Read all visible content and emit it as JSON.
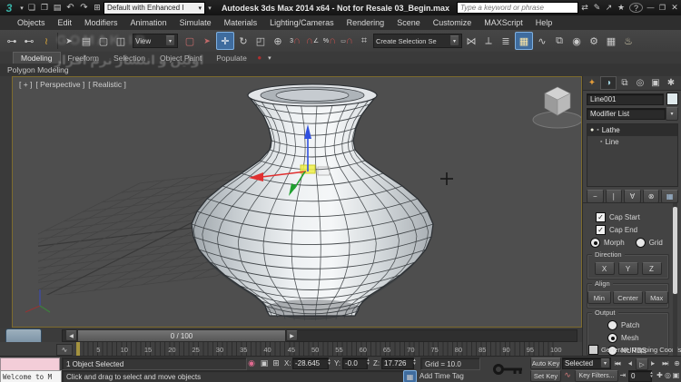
{
  "titlebar": {
    "title": "Autodesk 3ds Max 2014 x64  - Not for Resale   03_Begin.max",
    "workspace": "Default with Enhanced I",
    "search_placeholder": "Type a keyword or phrase"
  },
  "menus": [
    "Objects",
    "Edit",
    "Modifiers",
    "Animation",
    "Simulate",
    "Materials",
    "Lighting/Cameras",
    "Rendering",
    "Scene",
    "Customize",
    "MAXScript",
    "Help"
  ],
  "toolbar": {
    "ref_coord": "View",
    "selection_set": "Create Selection Se"
  },
  "ribbon": {
    "tabs": [
      "Modeling",
      "Freeform",
      "Selection",
      "Object Paint",
      "Populate"
    ],
    "panel": "Polygon Modeling"
  },
  "viewport": {
    "plus": "[ + ]",
    "view": "[ Perspective ]",
    "shading": "[ Realistic ]"
  },
  "panel": {
    "object_name": "Line001",
    "modifier_list": "Modifier List",
    "stack": [
      "Lathe",
      "Line"
    ],
    "cap_start": "Cap Start",
    "cap_end": "Cap End",
    "morph": "Morph",
    "grid": "Grid",
    "direction_label": "Direction",
    "dir": [
      "X",
      "Y",
      "Z"
    ],
    "align_label": "Align",
    "align": [
      "Min",
      "Center",
      "Max"
    ],
    "output_label": "Output",
    "output": [
      "Patch",
      "Mesh",
      "NURBS"
    ],
    "gen_map": "Generate Mapping Coords."
  },
  "timeline": {
    "slider": "0 / 100",
    "ticks": [
      5,
      10,
      15,
      20,
      25,
      30,
      35,
      40,
      45,
      50,
      55,
      60,
      65,
      70,
      75,
      80,
      85,
      90,
      95,
      100
    ]
  },
  "status": {
    "listener": "Welcome to M",
    "selected": "1 Object Selected",
    "prompt": "Click and drag to select and move objects",
    "x_label": "X:",
    "x": "-28.645",
    "y_label": "Y:",
    "y": "-0.0",
    "z_label": "Z:",
    "z": "17.726",
    "grid": "Grid = 10.0",
    "add_time_tag": "Add Time Tag",
    "auto_key": "Auto Key",
    "set_key": "Set Key",
    "selected_dd": "Selected",
    "key_filters": "Key Filters...",
    "frame": "0"
  },
  "watermark": {
    "latin": "GOMAK.IR",
    "persian": "اولین و انتشار نرم افزار"
  },
  "colors": {
    "accent_blue": "#3f6c9e",
    "viewport_bg": "#4e4e4e",
    "listener_pink": "#f3cdd8"
  },
  "icons": {
    "app": "3",
    "new": "❏",
    "open": "❐",
    "save": "▤",
    "undo": "↶",
    "redo": "↷",
    "proj": "⊞",
    "darr": "▾",
    "exch": "⇄",
    "wrench": "✎",
    "share": "↗",
    "star": "★",
    "help": "?",
    "min": "—",
    "max": "❐",
    "close": "✕",
    "link": "⊶",
    "unlink": "⊷",
    "bind": "≀",
    "sel": "➤",
    "byname": "▤",
    "region": "▢",
    "wincross": "◫",
    "move": "✛",
    "rotate": "↻",
    "scale": "◰",
    "pivot": "⊕",
    "magnet": "∩",
    "snap3": "3",
    "snapang": "∠",
    "snappct": "%",
    "snapspin": "▭",
    "editsets": "⌗",
    "mirror": "⋈",
    "aligntool": "⟂",
    "layers": "≣",
    "curveed": "∿",
    "schem": "⧉",
    "mtl": "◉",
    "rsetup": "⚙",
    "rframe": "▦",
    "render": "♨",
    "reddot": "●",
    "tab_create": "✦",
    "tab_modify": "◑",
    "tab_hier": "⧉",
    "tab_motion": "◎",
    "tab_disp": "▣",
    "tab_util": "✱",
    "bulb": "●",
    "sq": "▪",
    "pinstack": "−",
    "showend": "∣",
    "unique": "∀",
    "remove": "⊗",
    "config": "▦",
    "check": "✓",
    "ps": "|◀◀",
    "pf": "◀|",
    "play": "▷",
    "nf": "|▶",
    "pe": "▶▶|",
    "keystep": "⇥",
    "navzoom": "⊕",
    "navzoomall": "⊛",
    "navext": "⊡",
    "navmax": "▣",
    "navpan": "✚",
    "navorb": "◎",
    "timecfg": "◷",
    "statpin": "◉",
    "statlock": "▣",
    "statabs": "⊞",
    "addtag": "▦",
    "skcurve": "∿",
    "larr": "◀",
    "rarr": "▶",
    "spup": "▴",
    "spdn": "▾"
  }
}
